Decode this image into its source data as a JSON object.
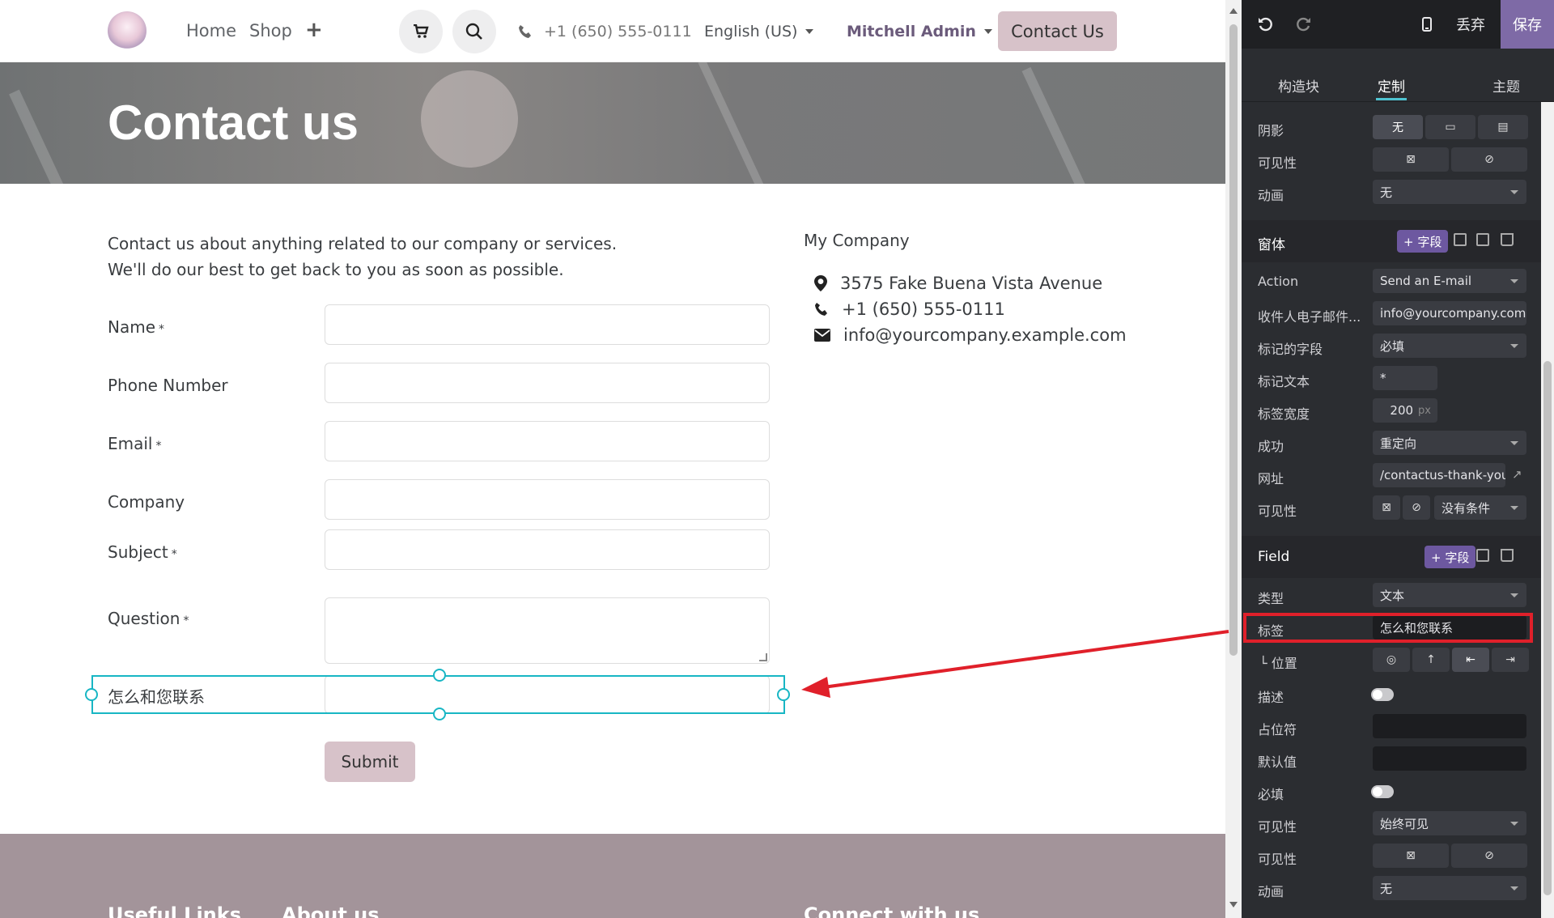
{
  "header": {
    "nav_home": "Home",
    "nav_shop": "Shop",
    "phone": "+1 (650) 555-0111",
    "language": "English (US)",
    "user": "Mitchell Admin",
    "contact_btn": "Contact Us"
  },
  "banner": {
    "title": "Contact us"
  },
  "form": {
    "intro_line1": "Contact us about anything related to our company or services.",
    "intro_line2": "We'll do our best to get back to you as soon as possible.",
    "required_mark": "*",
    "fields": [
      {
        "label": "Name",
        "required": true
      },
      {
        "label": "Phone Number",
        "required": false
      },
      {
        "label": "Email",
        "required": true
      },
      {
        "label": "Company",
        "required": false
      },
      {
        "label": "Subject",
        "required": true
      },
      {
        "label": "Question",
        "required": true
      },
      {
        "label": "怎么和您联系",
        "required": false
      }
    ],
    "submit": "Submit"
  },
  "company": {
    "name": "My Company",
    "address": "3575 Fake Buena Vista Avenue",
    "phone": "+1 (650) 555-0111",
    "email": "info@yourcompany.example.com"
  },
  "footer": {
    "col1": "Useful Links",
    "col2": "About us",
    "col3": "Connect with us"
  },
  "panel": {
    "discard": "丢弃",
    "save": "保存",
    "tabs": [
      "构造块",
      "定制",
      "主题"
    ],
    "shadow_label": "阴影",
    "shadow_none": "无",
    "visibility_label": "可见性",
    "animation_label": "动画",
    "animation_value": "无",
    "form_section": "窗体",
    "add_field": "+ 字段",
    "action_label": "Action",
    "action_value": "Send an E-mail",
    "recipient_label": "收件人电子邮件...",
    "recipient_value": "info@yourcompany.com",
    "marked_fields_label": "标记的字段",
    "marked_fields_value": "必填",
    "mark_text_label": "标记文本",
    "mark_text_value": "*",
    "label_width_label": "标签宽度",
    "label_width_value": "200",
    "label_width_unit": "px",
    "success_label": "成功",
    "success_value": "重定向",
    "url_label": "网址",
    "url_value": "/contactus-thank-you",
    "form_visibility_label": "可见性",
    "form_visibility_value": "没有条件",
    "field_section": "Field",
    "type_label": "类型",
    "type_value": "文本",
    "label_label": "标签",
    "label_value": "怎么和您联系",
    "position_label": "└ 位置",
    "description_label": "描述",
    "placeholder_label": "占位符",
    "default_label": "默认值",
    "required_label": "必填",
    "field_visibility_label": "可见性",
    "field_visibility_value": "始终可见",
    "field_visibility2_label": "可见性",
    "field_animation_label": "动画",
    "field_animation_value": "无"
  },
  "colors": {
    "accent": "#7e6aa6",
    "selection": "#18b6c4",
    "annotation": "#e0202a",
    "cta": "#d7c2c9"
  }
}
